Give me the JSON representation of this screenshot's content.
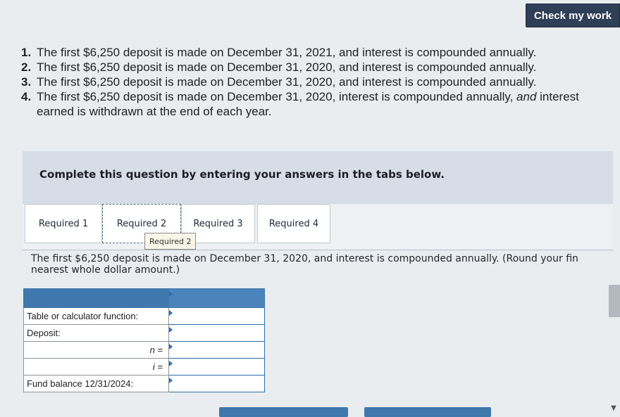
{
  "toolbar": {
    "check_label": "Check my work"
  },
  "problems": [
    {
      "num": "1.",
      "text": "The first $6,250 deposit is made on December 31, 2021, and interest is compounded annually."
    },
    {
      "num": "2.",
      "text": "The first $6,250 deposit is made on December 31, 2020, and interest is compounded annually."
    },
    {
      "num": "3.",
      "text": "The first $6,250 deposit is made on December 31, 2020, and interest is compounded annually."
    },
    {
      "num": "4.",
      "text_a": "The first $6,250 deposit is made on December 31, 2020, interest is compounded annually, ",
      "text_em": "and",
      "text_b": " interest earned is withdrawn at the end of each year."
    }
  ],
  "instructions": "Complete this question by entering your answers in the tabs below.",
  "tabs": [
    {
      "label": "Required 1"
    },
    {
      "label": "Required 2"
    },
    {
      "label": "Required 3"
    },
    {
      "label": "Required 4"
    }
  ],
  "tooltip": "Required 2",
  "description": "The first $6,250 deposit is made on December 31, 2020, and interest is compounded annually. (Round your fin",
  "description_line2": "nearest whole dollar amount.)",
  "table": {
    "rows": [
      {
        "label": "Table or calculator function:",
        "value": ""
      },
      {
        "label": "Deposit:",
        "value": ""
      },
      {
        "label": "n =",
        "value": ""
      },
      {
        "label": "i =",
        "value": ""
      },
      {
        "label": "Fund balance 12/31/2024:",
        "value": ""
      }
    ]
  }
}
